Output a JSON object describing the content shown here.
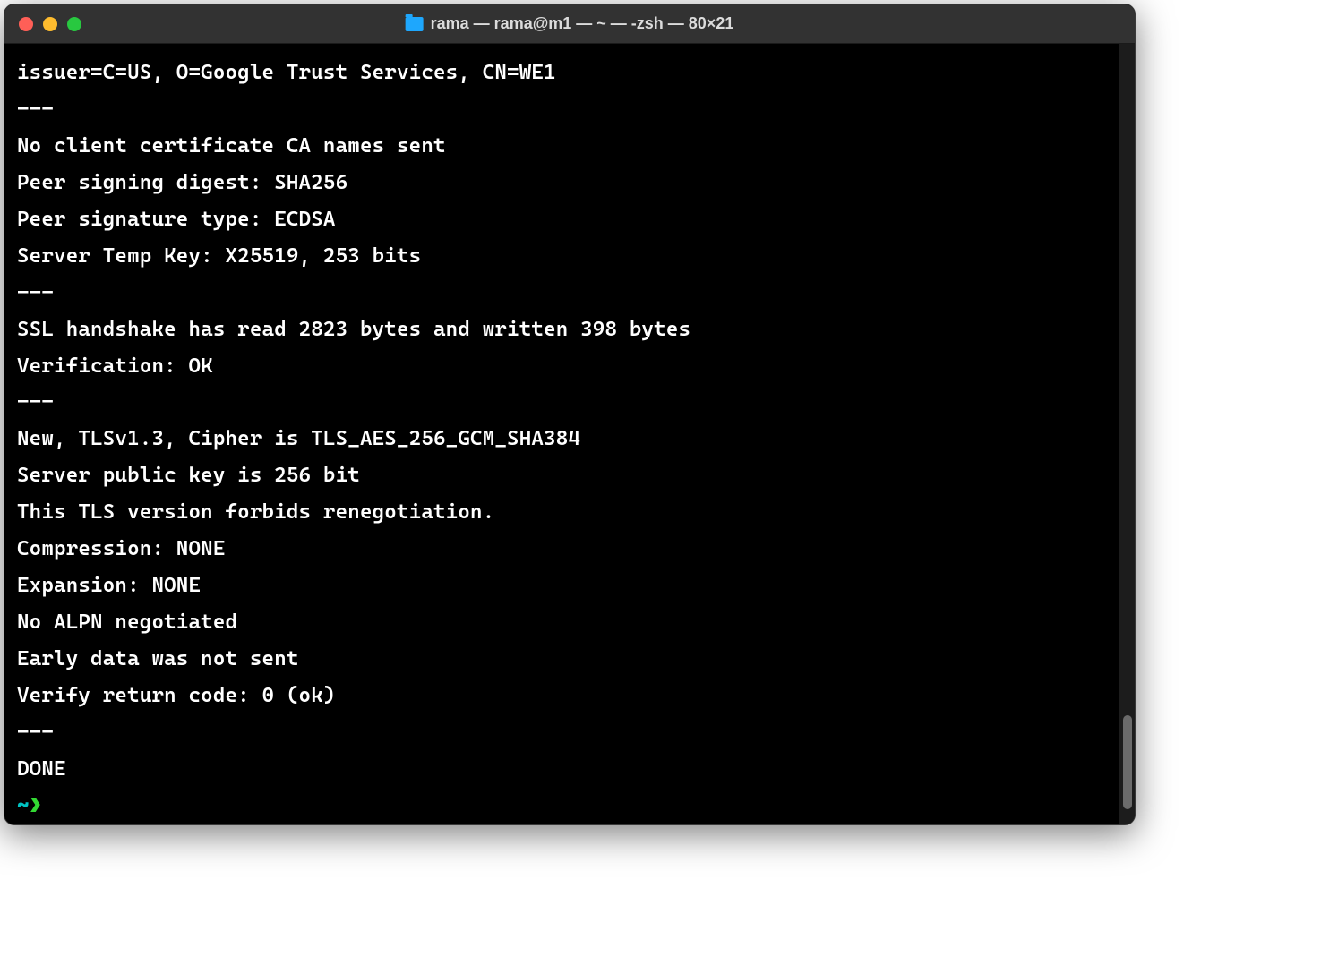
{
  "window": {
    "title": "rama — rama@m1 — ~ — -zsh — 80×21",
    "folder_icon": "folder-icon"
  },
  "traffic_lights": {
    "close": "close",
    "minimize": "minimize",
    "maximize": "maximize"
  },
  "terminal": {
    "lines": [
      "issuer=C=US, O=Google Trust Services, CN=WE1",
      "---",
      "No client certificate CA names sent",
      "Peer signing digest: SHA256",
      "Peer signature type: ECDSA",
      "Server Temp Key: X25519, 253 bits",
      "---",
      "SSL handshake has read 2823 bytes and written 398 bytes",
      "Verification: OK",
      "---",
      "New, TLSv1.3, Cipher is TLS_AES_256_GCM_SHA384",
      "Server public key is 256 bit",
      "This TLS version forbids renegotiation.",
      "Compression: NONE",
      "Expansion: NONE",
      "No ALPN negotiated",
      "Early data was not sent",
      "Verify return code: 0 (ok)",
      "---",
      "DONE"
    ],
    "prompt": {
      "tilde": "~",
      "arrow": "❯"
    }
  },
  "scrollbar": {
    "thumb_top_pct": 86,
    "thumb_height_pct": 12
  }
}
